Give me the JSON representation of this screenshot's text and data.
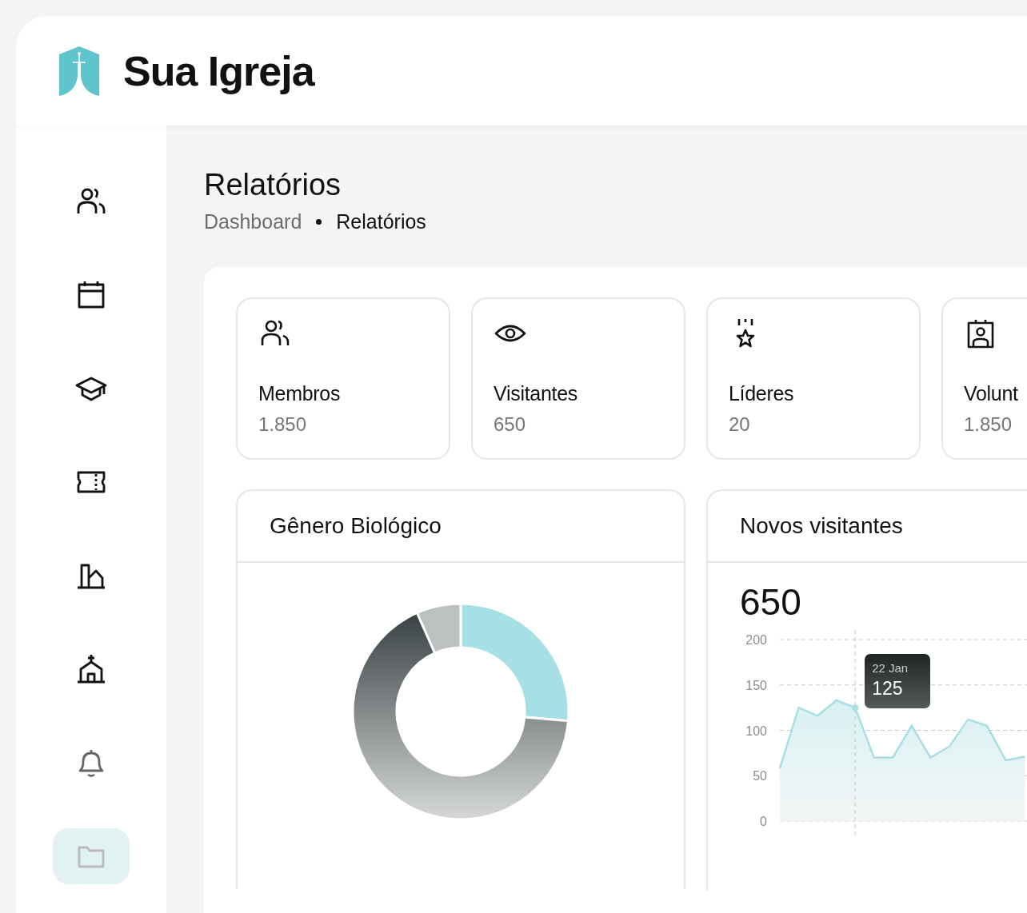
{
  "brand": {
    "name": "Sua Igreja"
  },
  "sidebar": {
    "items": [
      {
        "kind": "people",
        "selected": false
      },
      {
        "kind": "calendar",
        "selected": false
      },
      {
        "kind": "graduation",
        "selected": false
      },
      {
        "kind": "ticket",
        "selected": false
      },
      {
        "kind": "buildings",
        "selected": false
      },
      {
        "kind": "church",
        "selected": false
      },
      {
        "kind": "bell",
        "selected": false
      },
      {
        "kind": "folder",
        "selected": true
      }
    ]
  },
  "page": {
    "title": "Relatórios",
    "breadcrumb": [
      "Dashboard",
      "Relatórios"
    ]
  },
  "stats": [
    {
      "kind": "people",
      "label": "Membros",
      "value": "1.850"
    },
    {
      "kind": "eye",
      "label": "Visitantes",
      "value": "650"
    },
    {
      "kind": "medal",
      "label": "Líderes",
      "value": "20"
    },
    {
      "kind": "badge",
      "label": "Volunt",
      "value": "1.850"
    }
  ],
  "gender": {
    "title": "Gênero Biológico"
  },
  "visitors": {
    "title": "Novos visitantes",
    "total": "650",
    "tooltip": {
      "date": "22 Jan",
      "value": "125"
    },
    "chart_data": {
      "type": "area",
      "ylim": [
        0,
        200
      ],
      "yticks": [
        0,
        50,
        100,
        150,
        200
      ],
      "grid": true,
      "series": [
        {
          "color": "#a8dfe4",
          "values": [
            58,
            125,
            116,
            133,
            125,
            70,
            70,
            105,
            70,
            82,
            112,
            105,
            67,
            71
          ]
        }
      ]
    }
  }
}
